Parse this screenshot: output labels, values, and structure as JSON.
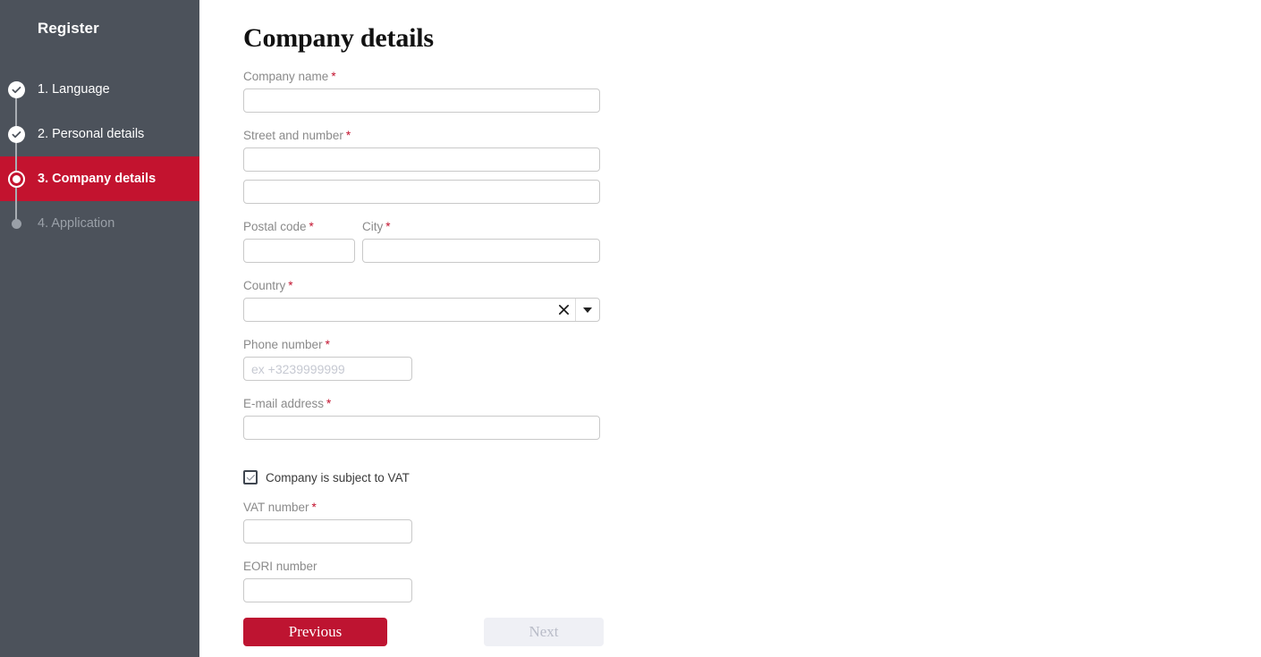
{
  "sidebar": {
    "title": "Register",
    "steps": [
      {
        "label": "1. Language",
        "state": "done"
      },
      {
        "label": "2. Personal details",
        "state": "done"
      },
      {
        "label": "3. Company details",
        "state": "active"
      },
      {
        "label": "4. Application",
        "state": "todo"
      }
    ],
    "colors": {
      "background": "#4c525b",
      "active": "#c3132f",
      "muted_text": "#9aa0a8"
    }
  },
  "main": {
    "page_title": "Company details",
    "required_marker": "*",
    "fields": {
      "company_name": {
        "label": "Company name",
        "value": "",
        "placeholder": ""
      },
      "street": {
        "label": "Street and number",
        "value": "",
        "placeholder": ""
      },
      "street2": {
        "label": "",
        "value": "",
        "placeholder": ""
      },
      "postal_code": {
        "label": "Postal code",
        "value": "",
        "placeholder": ""
      },
      "city": {
        "label": "City",
        "value": "",
        "placeholder": ""
      },
      "country": {
        "label": "Country",
        "value": "",
        "clear_icon": "close-icon",
        "dropdown_icon": "chevron-down-icon"
      },
      "phone": {
        "label": "Phone number",
        "value": "",
        "placeholder": "ex +3239999999"
      },
      "email": {
        "label": "E-mail address",
        "value": "",
        "placeholder": ""
      },
      "vat_number": {
        "label": "VAT number",
        "value": "",
        "placeholder": ""
      },
      "eori_number": {
        "label": "EORI number",
        "value": "",
        "placeholder": ""
      }
    },
    "vat_checkbox": {
      "label": "Company is subject to VAT",
      "checked": true
    },
    "buttons": {
      "previous": "Previous",
      "next": "Next",
      "next_disabled": true
    },
    "colors": {
      "accent_red": "#be1431",
      "label_gray": "#8a8a8a",
      "border_gray": "#c9c9c9",
      "next_disabled_bg": "#eff0f5"
    }
  }
}
